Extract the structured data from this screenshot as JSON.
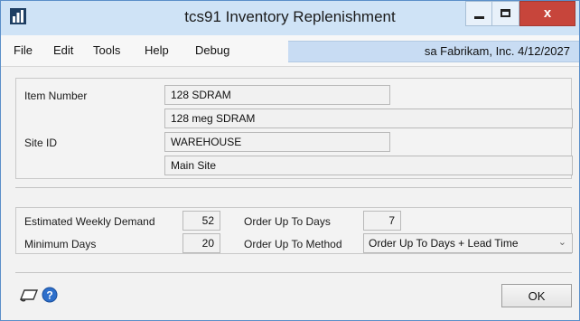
{
  "window": {
    "title": "tcs91 Inventory Replenishment"
  },
  "menu": {
    "items": [
      {
        "label": "File"
      },
      {
        "label": "Edit"
      },
      {
        "label": "Tools"
      },
      {
        "label": "Help"
      },
      {
        "label": "Debug"
      }
    ],
    "company_info": "sa  Fabrikam, Inc.  4/12/2027"
  },
  "item": {
    "item_number_label": "Item Number",
    "item_number": "128 SDRAM",
    "item_description": "128 meg SDRAM",
    "site_id_label": "Site ID",
    "site_id": "WAREHOUSE",
    "site_description": "Main Site"
  },
  "demand": {
    "estimated_weekly_demand_label": "Estimated Weekly Demand",
    "estimated_weekly_demand": "52",
    "minimum_days_label": "Minimum Days",
    "minimum_days": "20",
    "order_up_to_days_label": "Order Up To Days",
    "order_up_to_days": "7",
    "order_up_to_method_label": "Order Up To Method",
    "order_up_to_method": "Order Up To Days + Lead Time"
  },
  "buttons": {
    "ok": "OK"
  },
  "icons": {
    "app": "window-app-icon",
    "note": "note-icon",
    "help": "help-icon",
    "chevron": "chevron-down-icon"
  },
  "colors": {
    "titlebar": "#cfe3f6",
    "close_button": "#c7453b",
    "company_band": "#c8dcf3",
    "help_icon": "#2d6fcb"
  }
}
